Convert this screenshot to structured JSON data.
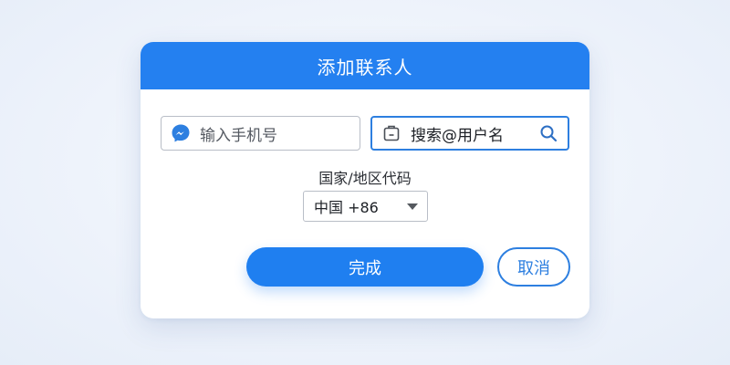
{
  "dialog": {
    "title": "添加联系人",
    "phone_field": {
      "placeholder": "输入手机号",
      "icon": "messenger-icon"
    },
    "search_field": {
      "value": "搜索@用户名",
      "icon": "badge-icon",
      "search_icon": "search-icon"
    },
    "country": {
      "label": "国家/地区代码",
      "selected": "中国 +86"
    },
    "done_label": "完成",
    "cancel_label": "取消"
  },
  "colors": {
    "accent": "#2480f0",
    "border": "#b9bec7",
    "text": "#1d2026"
  }
}
